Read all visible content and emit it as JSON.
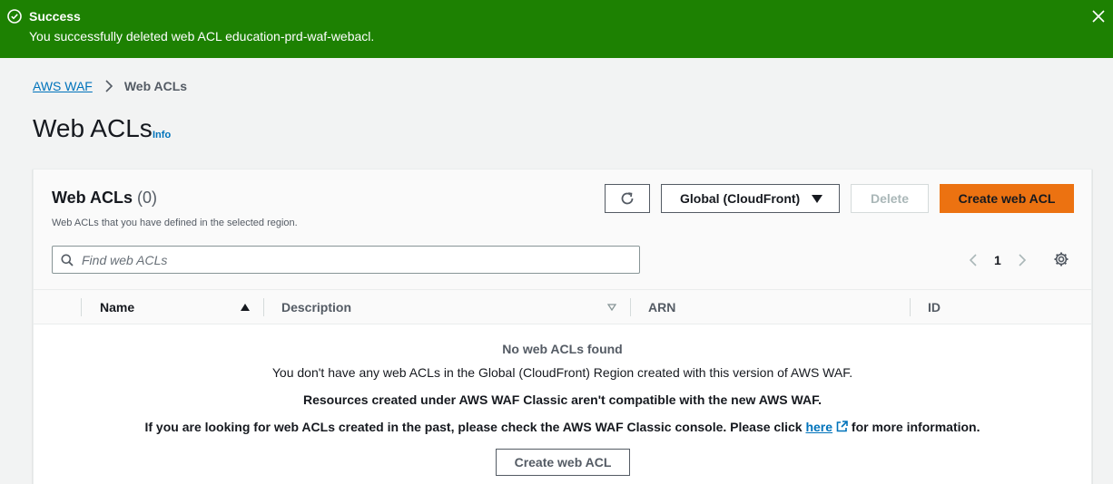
{
  "flash": {
    "title": "Success",
    "message": "You successfully deleted web ACL education-prd-waf-webacl.",
    "icon": "check-circle-icon",
    "color": "#1d8102"
  },
  "breadcrumb": {
    "root": "AWS WAF",
    "current": "Web ACLs"
  },
  "page": {
    "title": "Web ACLs",
    "info": "Info"
  },
  "table": {
    "title": "Web ACLs",
    "count": "(0)",
    "description": "Web ACLs that you have defined in the selected region.",
    "region_label": "Global (CloudFront)",
    "delete_label": "Delete",
    "create_label": "Create web ACL",
    "search_placeholder": "Find web ACLs",
    "page_number": "1",
    "columns": [
      "Name",
      "Description",
      "ARN",
      "ID"
    ],
    "empty": {
      "title": "No web ACLs found",
      "line1": "You don't have any web ACLs in the Global (CloudFront) Region created with this version of AWS WAF.",
      "line2": "Resources created under AWS WAF Classic aren't compatible with the new AWS WAF.",
      "line3_before": "If you are looking for web ACLs created in the past, please check the AWS WAF Classic console. Please click ",
      "line3_link": "here",
      "line3_after": " for more information.",
      "create_label": "Create web ACL"
    }
  },
  "colors": {
    "accent": "#ec7211",
    "link": "#0073bb"
  }
}
